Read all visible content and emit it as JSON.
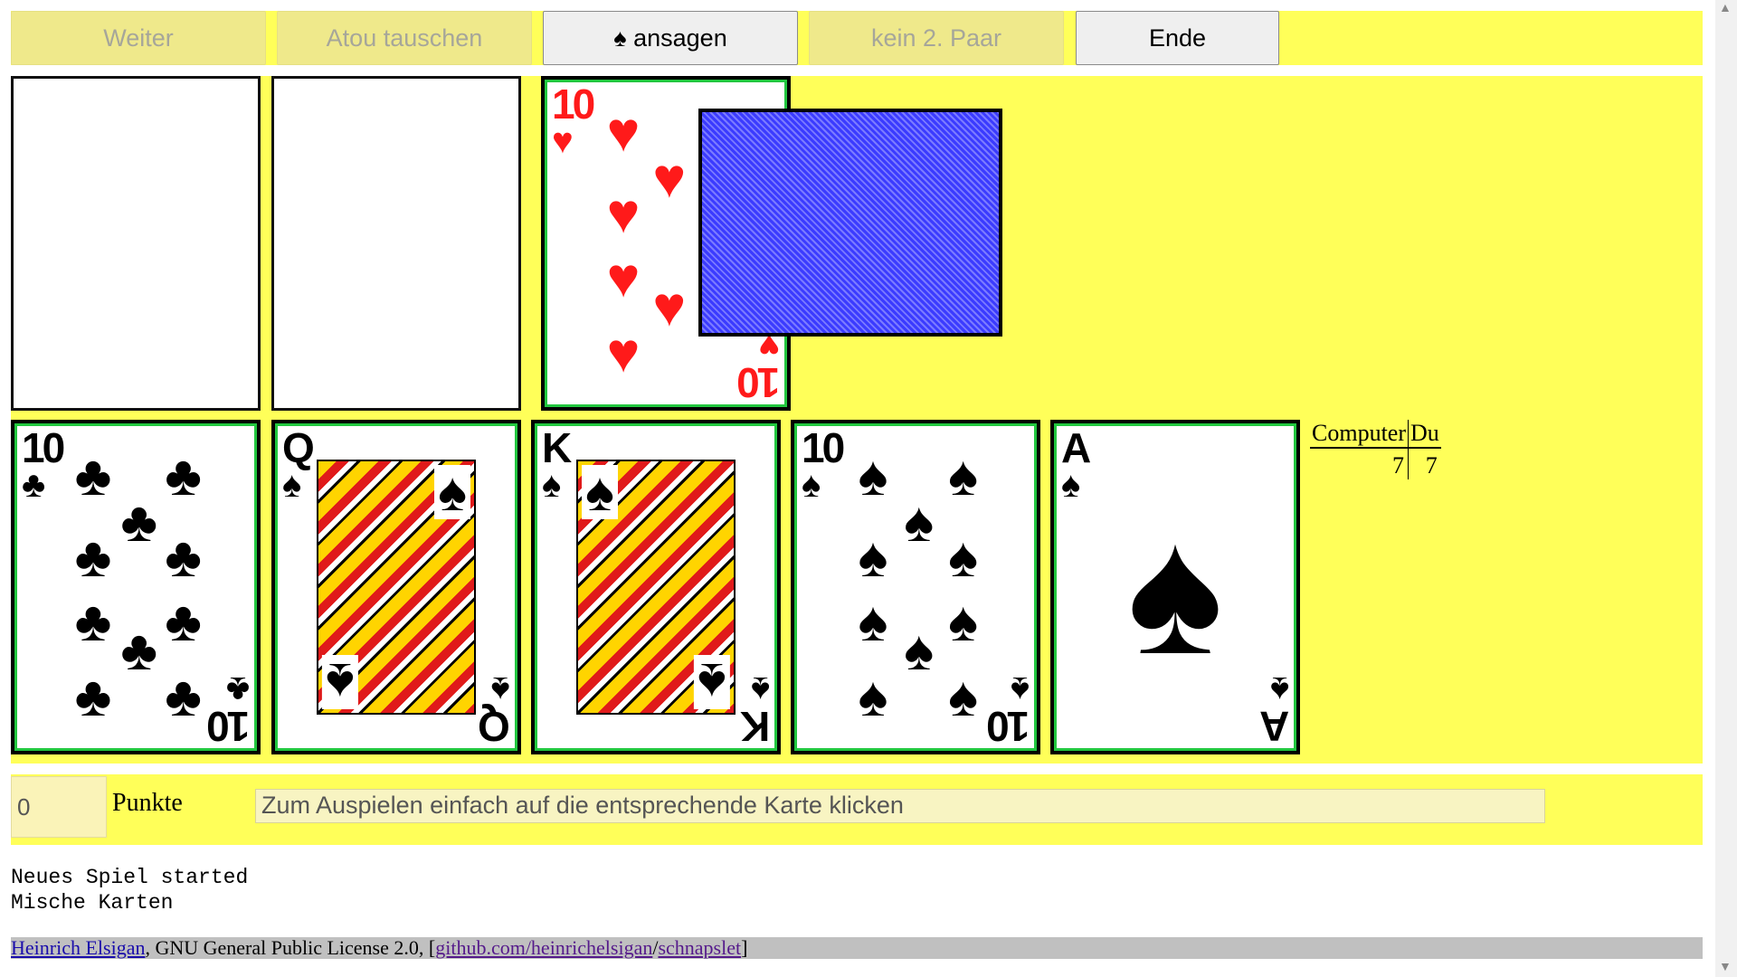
{
  "toolbar": {
    "continue": "Weiter",
    "swap_trump": "Atou tauschen",
    "announce": "♠ ansagen",
    "no_second_pair": "kein 2. Paar",
    "end": "Ende"
  },
  "table": {
    "stock_cards": [
      {
        "name": "empty-slot-1"
      },
      {
        "name": "empty-slot-2"
      }
    ],
    "trump_card": {
      "rank": "10",
      "suit": "♥",
      "color": "red"
    },
    "deck": {
      "label": "card back"
    }
  },
  "hand": [
    {
      "rank": "10",
      "suit": "♣"
    },
    {
      "rank": "Q",
      "suit": "♠"
    },
    {
      "rank": "K",
      "suit": "♠"
    },
    {
      "rank": "10",
      "suit": "♠"
    },
    {
      "rank": "A",
      "suit": "♠"
    }
  ],
  "score": {
    "headers": [
      "Computer",
      "Du"
    ],
    "values": [
      "7",
      "7"
    ]
  },
  "bottom": {
    "points_value": "0",
    "points_label": "Punkte",
    "status_text": "Zum Auspielen einfach auf die entsprechende Karte klicken"
  },
  "log": [
    "Neues Spiel started",
    "Mische Karten"
  ],
  "footer": {
    "author": "Heinrich Elsigan",
    "license": ", GNU General Public License 2.0, [",
    "repo_link": "github.com/heinrichelsigan",
    "slash": "/",
    "project_link": "schnapslet",
    "close": "]"
  },
  "colors": {
    "table_bg": "#ffff59",
    "card_back": "#7b7bff",
    "button_disabled": "#efe98b"
  }
}
